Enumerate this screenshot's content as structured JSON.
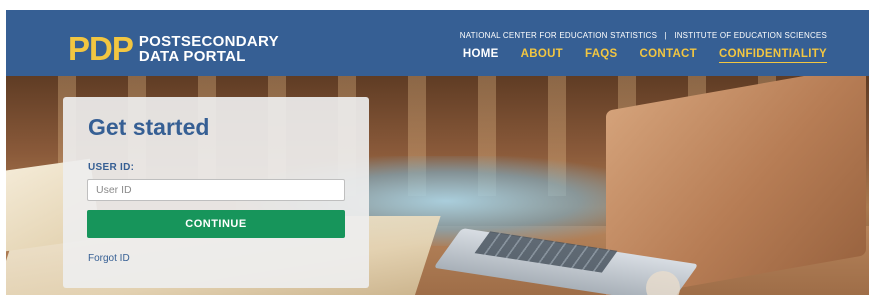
{
  "header": {
    "logo_mark": "PDP",
    "logo_line1": "POSTSECONDARY",
    "logo_line2": "DATA PORTAL",
    "top_link_1": "NATIONAL CENTER FOR EDUCATION STATISTICS",
    "top_separator": "|",
    "top_link_2": "INSTITUTE OF EDUCATION SCIENCES",
    "nav": [
      {
        "label": "HOME"
      },
      {
        "label": "ABOUT"
      },
      {
        "label": "FAQS"
      },
      {
        "label": "CONTACT"
      },
      {
        "label": "CONFIDENTIALITY"
      }
    ]
  },
  "login": {
    "title": "Get started",
    "userid_label": "USER ID:",
    "userid_placeholder": "User ID",
    "userid_value": "",
    "continue_label": "CONTINUE",
    "forgot_label": "Forgot ID"
  },
  "colors": {
    "header_bg": "#365f94",
    "accent_yellow": "#f2c641",
    "button_green": "#17955b",
    "title_blue": "#365f94"
  }
}
